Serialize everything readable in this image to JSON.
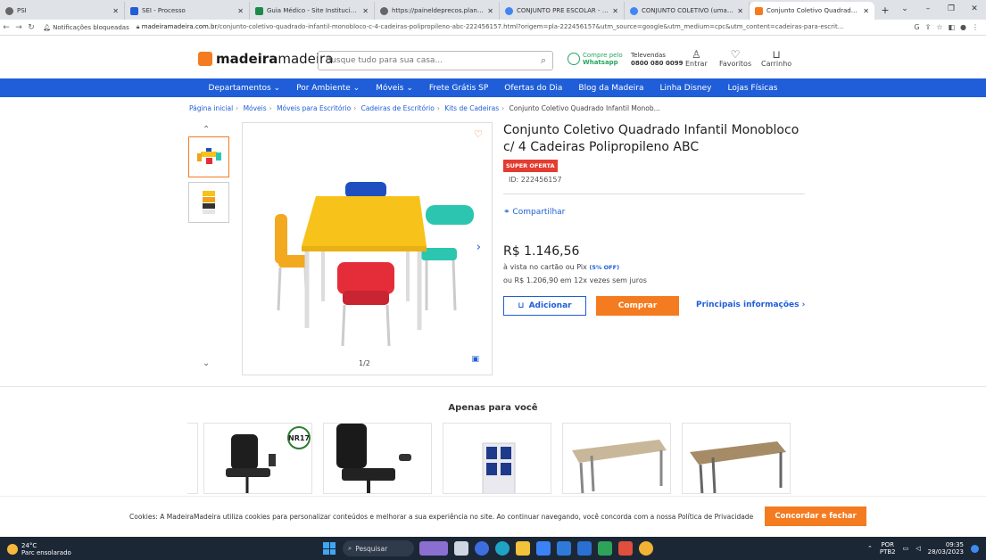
{
  "browser": {
    "tabs": [
      {
        "label": "PSI",
        "color": "#666666"
      },
      {
        "label": "SEI - Processo",
        "color": "#1f5ed8"
      },
      {
        "label": "Guia Médico - Site Institucional",
        "color": "#1e8a4a"
      },
      {
        "label": "https://paineldeprecos.planejam...",
        "color": "#666666"
      },
      {
        "label": "CONJUNTO PRE ESCOLAR - ME",
        "color": "#4285f4"
      },
      {
        "label": "CONJUNTO COLETIVO (uma me...",
        "color": "#4285f4"
      },
      {
        "label": "Conjunto Coletivo Quadrado Inf...",
        "color": "#f47b20"
      }
    ],
    "new_tab": "+",
    "notifications": "Notificações bloqueadas",
    "url_host": "madeiramadeira.com.br",
    "url_path": "/conjunto-coletivo-quadrado-infantil-monobloco-c-4-cadeiras-polipropileno-abc-222456157.html?origem=pla-222456157&utm_source=google&utm_medium=cpc&utm_content=cadeiras-para-escrit..."
  },
  "header": {
    "logo_bold": "madeira",
    "logo_regular": "madeira",
    "search_placeholder": "Busque tudo para sua casa...",
    "whatsapp_line1": "Compre pelo",
    "whatsapp_line2": "Whatsapp",
    "tel_line1": "Televendas",
    "tel_line2": "0800 080 0099",
    "login": "Entrar",
    "favorites": "Favoritos",
    "cart": "Carrinho"
  },
  "menu": [
    "Departamentos ⌄",
    "Por Ambiente ⌄",
    "Móveis ⌄",
    "Frete Grátis SP",
    "Ofertas do Dia",
    "Blog da Madeira",
    "Linha Disney",
    "Lojas Físicas"
  ],
  "breadcrumb": [
    "Página inicial",
    "Móveis",
    "Móveis para Escritório",
    "Cadeiras de Escritório",
    "Kits de Cadeiras"
  ],
  "breadcrumb_current": "Conjunto Coletivo Quadrado Infantil Monob...",
  "product": {
    "title": "Conjunto Coletivo Quadrado Infantil Monobloco c/ 4 Cadeiras Polipropileno ABC",
    "badge": "SUPER OFERTA",
    "id": "ID: 222456157",
    "share": "Compartilhar",
    "price": "R$ 1.146,56",
    "price_line1": "à vista no cartão ou Pix",
    "discount": "(5% OFF)",
    "price_line2": "ou R$ 1.206,90 em 12x vezes sem juros",
    "add_button": "Adicionar",
    "buy_button": "Comprar",
    "info_link": "Principais informações ›",
    "image_counter": "1/2"
  },
  "recommendations": {
    "title": "Apenas para você",
    "badge_text": "NR17"
  },
  "cookie": {
    "text": "Cookies: A MadeiraMadeira utiliza cookies para personalizar conteúdos e melhorar a sua experiência no site. Ao continuar navegando, você concorda com a nossa Política de Privacidade",
    "button": "Concordar e fechar"
  },
  "taskbar": {
    "temp": "24°C",
    "weather": "Parc ensolarado",
    "search": "Pesquisar",
    "lang1": "POR",
    "lang2": "PTB2",
    "time": "09:35",
    "date": "28/03/2023"
  },
  "colors": {
    "brand_blue": "#1f5ed8",
    "brand_orange": "#f47b20",
    "offer_red": "#e43c31"
  }
}
